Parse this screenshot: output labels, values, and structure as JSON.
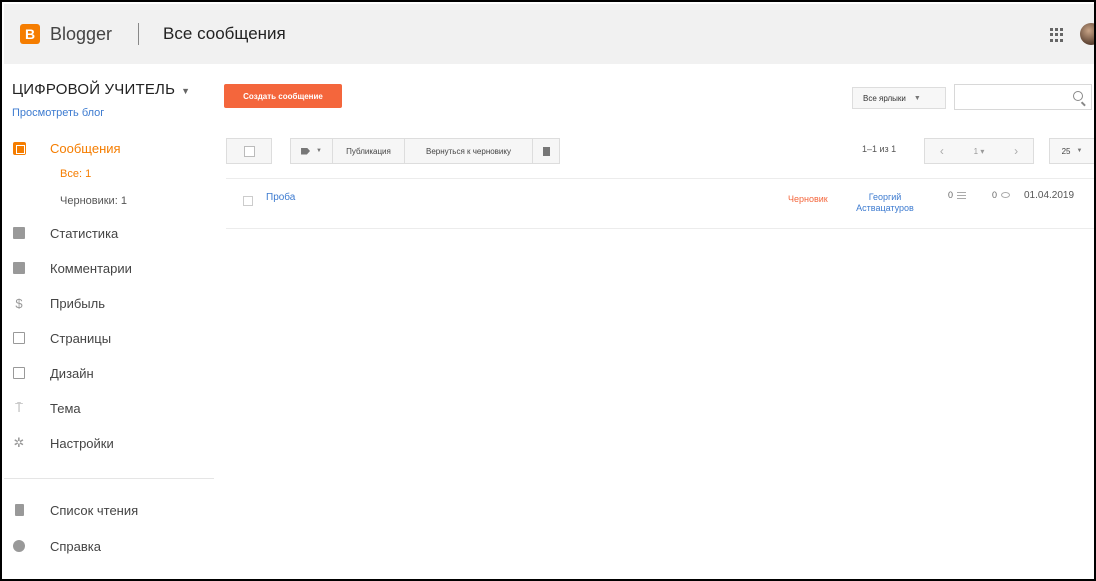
{
  "header": {
    "logo_letter": "B",
    "brand": "Blogger",
    "title": "Все сообщения"
  },
  "sidebar": {
    "blog_name": "ЦИФРОВОЙ УЧИТЕЛЬ",
    "view_blog": "Просмотреть блог",
    "posts": "Сообщения",
    "sub_all": "Все: 1",
    "sub_drafts": "Черновики: 1",
    "stats": "Статистика",
    "comments": "Комментарии",
    "earnings": "Прибыль",
    "pages": "Страницы",
    "layout": "Дизайн",
    "theme": "Тема",
    "settings": "Настройки",
    "reading_list": "Список чтения",
    "help": "Справка"
  },
  "toolbar": {
    "create_post": "Создать сообщение",
    "labels_dropdown": "Все ярлыки",
    "publish": "Публикация",
    "revert_to_draft": "Вернуться к черновику",
    "pager_text": "1–1 из 1",
    "pager_mid": "1",
    "page_size": "25"
  },
  "posts": [
    {
      "title": "Проба",
      "status": "Черновик",
      "author": "Георгий Аствацатуров",
      "comments": "0",
      "views": "0",
      "date": "01.04.2019"
    }
  ],
  "colors": {
    "accent": "#f57d00",
    "create_button": "#f4663c",
    "link": "#3d7bd0"
  }
}
